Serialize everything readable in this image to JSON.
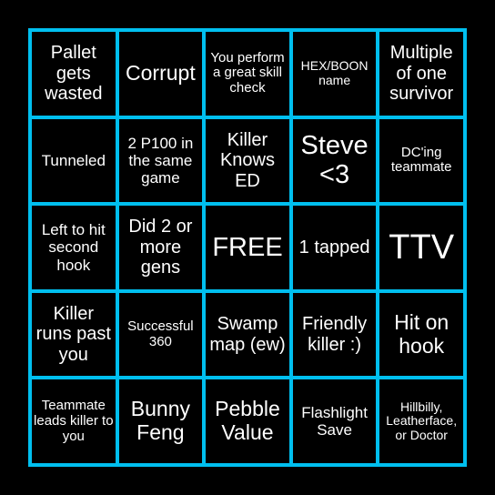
{
  "board": {
    "accent_color": "#00bfef",
    "cells": [
      {
        "text": "Pallet gets wasted",
        "size": "s4"
      },
      {
        "text": "Corrupt",
        "size": "s5"
      },
      {
        "text": "You perform a great skill check",
        "size": "s2"
      },
      {
        "text": "HEX/BOON name",
        "size": "s1"
      },
      {
        "text": "Multiple of one survivor",
        "size": "s4"
      },
      {
        "text": "Tunneled",
        "size": "s3"
      },
      {
        "text": "2 P100 in the same game",
        "size": "s3"
      },
      {
        "text": "Killer Knows ED",
        "size": "s4"
      },
      {
        "text": "Steve <3",
        "size": "s6"
      },
      {
        "text": "DC'ing teammate",
        "size": "s2"
      },
      {
        "text": "Left to hit second hook",
        "size": "s3"
      },
      {
        "text": "Did 2 or more gens",
        "size": "s4"
      },
      {
        "text": "FREE",
        "size": "s6"
      },
      {
        "text": "1 tapped",
        "size": "s4"
      },
      {
        "text": "TTV",
        "size": "s7"
      },
      {
        "text": "Killer runs past you",
        "size": "s4"
      },
      {
        "text": "Successful 360",
        "size": "s2"
      },
      {
        "text": "Swamp map (ew)",
        "size": "s4"
      },
      {
        "text": "Friendly killer :)",
        "size": "s4"
      },
      {
        "text": "Hit on hook",
        "size": "s5"
      },
      {
        "text": "Teammate leads killer to you",
        "size": "s2"
      },
      {
        "text": "Bunny Feng",
        "size": "s5"
      },
      {
        "text": "Pebble Value",
        "size": "s5"
      },
      {
        "text": "Flashlight Save",
        "size": "s3"
      },
      {
        "text": "Hillbilly, Leatherface, or Doctor",
        "size": "s1"
      }
    ]
  }
}
